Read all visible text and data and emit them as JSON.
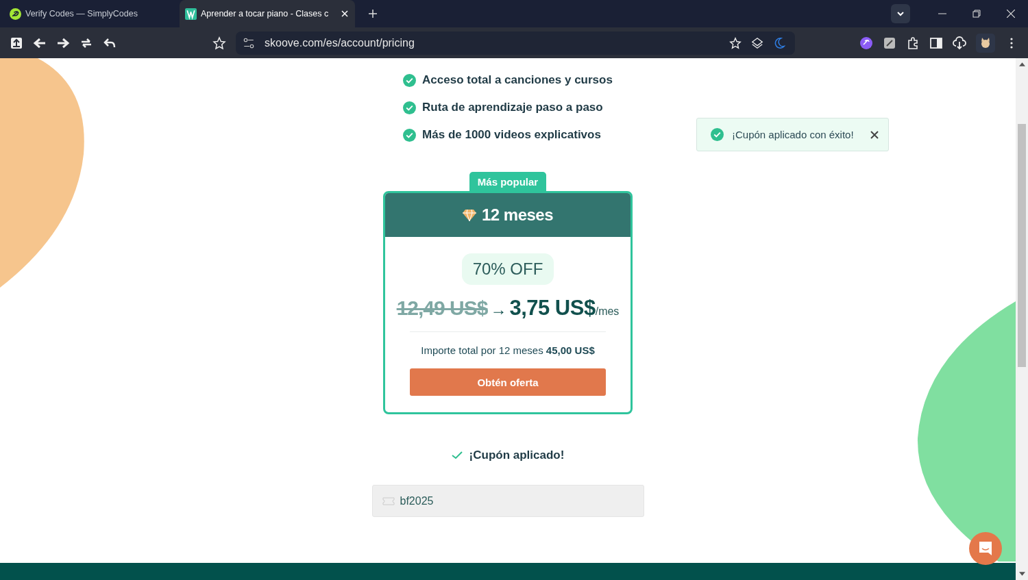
{
  "browser": {
    "tabs": [
      {
        "title": "Verify Codes — SimplyCodes",
        "selected": false
      },
      {
        "title": "Aprender a tocar piano - Clases c",
        "selected": true
      }
    ],
    "url": "skoove.com/es/account/pricing"
  },
  "features": [
    "Acceso total a canciones y cursos",
    "Ruta de aprendizaje paso a paso",
    "Más de 1000 videos explicativos"
  ],
  "toast": {
    "message": "¡Cupón aplicado con éxito!"
  },
  "plan": {
    "badge": "Más popular",
    "title": "12 meses",
    "discount": "70% OFF",
    "old_price": "12,49 US$",
    "arrow": "→",
    "price": "3,75 US$",
    "per": "/mes",
    "total_label": "Importe total por 12 meses",
    "total_value": "45,00 US$",
    "button": "Obtén oferta"
  },
  "coupon": {
    "status": "¡Cupón aplicado!",
    "code": "bf2025"
  }
}
